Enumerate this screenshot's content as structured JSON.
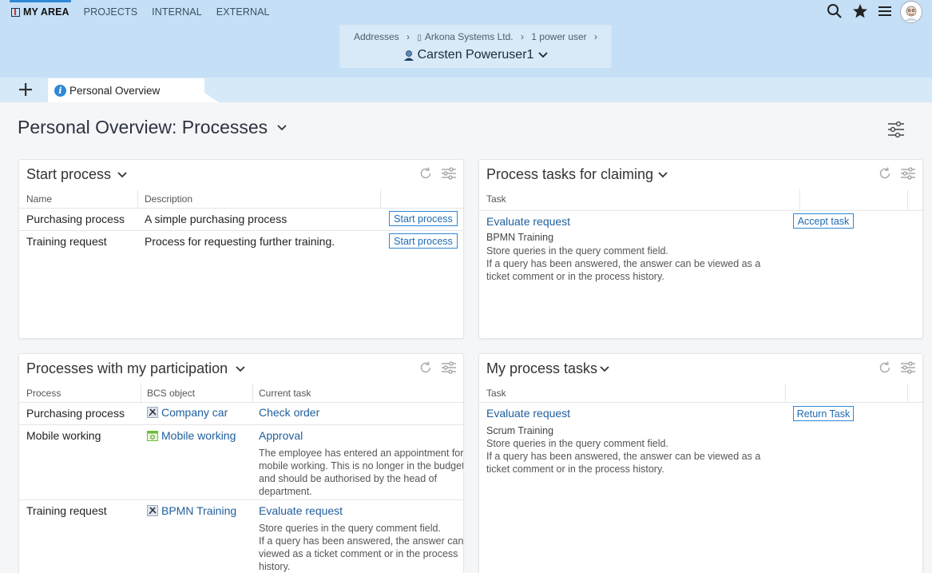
{
  "nav": {
    "my_area": "MY AREA",
    "projects": "PROJECTS",
    "internal": "INTERNAL",
    "external": "EXTERNAL"
  },
  "breadcrumb": {
    "addresses": "Addresses",
    "company": "Arkona Systems Ltd.",
    "level": "1 power user",
    "sep": "›"
  },
  "context_person": "Carsten Poweruser1",
  "tab": {
    "label": "Personal Overview"
  },
  "page_title": "Personal Overview: Processes",
  "start_process": {
    "title": "Start process",
    "col_name": "Name",
    "col_desc": "Description",
    "rows": [
      {
        "name": "Purchasing process",
        "desc": "A simple purchasing process",
        "button": "Start process"
      },
      {
        "name": "Training request",
        "desc": "Process for requesting further training.",
        "button": "Start process"
      }
    ]
  },
  "claim_tasks": {
    "title": "Process tasks for claiming",
    "col_task": "Task",
    "task_link": "Evaluate request",
    "task_sub": "BPMN Training",
    "task_desc": [
      "Store queries in the query comment field.",
      "If a query has been answered, the answer can be viewed as a",
      "ticket comment or in the process history."
    ],
    "button": "Accept task"
  },
  "participation": {
    "title": "Processes with my participation",
    "col_process": "Process",
    "col_bcs": "BCS object",
    "col_task": "Current task",
    "rows": [
      {
        "process": "Purchasing process",
        "bcs": "Company car",
        "task": "Check order",
        "desc": []
      },
      {
        "process": "Mobile working",
        "bcs": "Mobile working",
        "task": "Approval",
        "desc": [
          "The employee has entered an appointment for",
          "mobile working. This is no longer in the budget",
          "and should be authorised by the head of",
          "department."
        ]
      },
      {
        "process": "Training request",
        "bcs": "BPMN Training",
        "task": "Evaluate request",
        "desc": [
          "Store queries in the query comment field.",
          "If a query has been answered, the answer can",
          "viewed as a ticket comment or in the process",
          "history."
        ]
      }
    ]
  },
  "my_tasks": {
    "title": "My process tasks",
    "col_task": "Task",
    "task_link": "Evaluate request",
    "task_sub": "Scrum Training",
    "task_desc": [
      "Store queries in the query comment field.",
      "If a query has been answered, the answer can be viewed as a",
      "ticket comment or in the process history."
    ],
    "button": "Return Task"
  },
  "colors": {
    "accent": "#2f88d6",
    "link": "#1f5e9c",
    "header_bg": "#c5e0f6"
  }
}
